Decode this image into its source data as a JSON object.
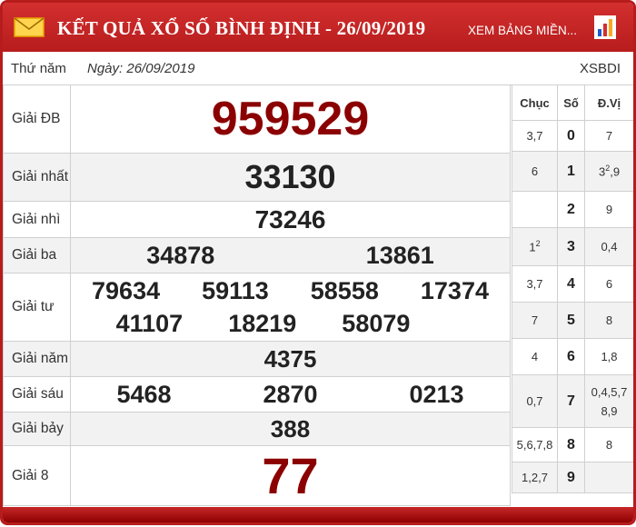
{
  "header": {
    "title": "KẾT QUẢ XỔ SỐ BÌNH ĐỊNH - 26/09/2019",
    "link": "XEM BẢNG MIỀN..."
  },
  "subheader": {
    "day": "Thứ năm",
    "date": "Ngày: 26/09/2019",
    "code": "XSBDI"
  },
  "prizes": {
    "db": {
      "label": "Giải ĐB",
      "numbers": [
        "959529"
      ]
    },
    "nhat": {
      "label": "Giải nhất",
      "numbers": [
        "33130"
      ]
    },
    "nhi": {
      "label": "Giải nhì",
      "numbers": [
        "73246"
      ]
    },
    "ba": {
      "label": "Giải ba",
      "numbers": [
        "34878",
        "13861"
      ]
    },
    "tu": {
      "label": "Giải tư",
      "numbers": [
        "79634",
        "59113",
        "58558",
        "17374",
        "41107",
        "18219",
        "58079"
      ]
    },
    "nam": {
      "label": "Giải năm",
      "numbers": [
        "4375"
      ]
    },
    "sau": {
      "label": "Giải sáu",
      "numbers": [
        "5468",
        "2870",
        "0213"
      ]
    },
    "bay": {
      "label": "Giải bảy",
      "numbers": [
        "388"
      ]
    },
    "tam": {
      "label": "Giải 8",
      "numbers": [
        "77"
      ]
    }
  },
  "loto": {
    "headers": {
      "chuc": "Chục",
      "so": "Số",
      "dvi": "Đ.Vị"
    },
    "rows": [
      {
        "chuc": "3,7",
        "so": "0",
        "dvi": "7"
      },
      {
        "chuc": "6",
        "so": "1",
        "dvi": "3",
        "dvi_sup": "2",
        "dvi_after": ",9"
      },
      {
        "chuc": "",
        "so": "2",
        "dvi": "9"
      },
      {
        "chuc": "1",
        "chuc_sup": "2",
        "so": "3",
        "dvi": "0,4"
      },
      {
        "chuc": "3,7",
        "so": "4",
        "dvi": "6"
      },
      {
        "chuc": "7",
        "so": "5",
        "dvi": "8"
      },
      {
        "chuc": "4",
        "so": "6",
        "dvi": "1,8"
      },
      {
        "chuc": "0,7",
        "so": "7",
        "dvi": "0,4,5,7",
        "dvi_line2": "8,9"
      },
      {
        "chuc": "5,6,7,8",
        "so": "8",
        "dvi": "8"
      },
      {
        "chuc": "1,2,7",
        "so": "9",
        "dvi": ""
      }
    ]
  }
}
